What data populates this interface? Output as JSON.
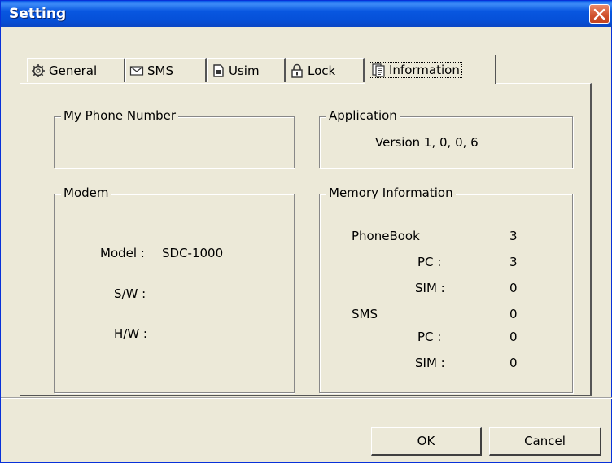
{
  "window": {
    "title": "Setting"
  },
  "tabs": [
    {
      "label": "General",
      "icon": "gear-icon"
    },
    {
      "label": "SMS",
      "icon": "envelope-icon"
    },
    {
      "label": "Usim",
      "icon": "sim-card-icon"
    },
    {
      "label": "Lock",
      "icon": "lock-icon"
    },
    {
      "label": "Information",
      "icon": "document-icon",
      "active": true
    }
  ],
  "phone_number": {
    "title": "My Phone Number",
    "value": ""
  },
  "application": {
    "title": "Application",
    "version": "Version 1, 0, 0, 6"
  },
  "modem": {
    "title": "Modem",
    "model_label": "Model :",
    "model_value": "SDC-1000",
    "sw_label": "S/W :",
    "sw_value": "",
    "hw_label": "H/W :",
    "hw_value": ""
  },
  "memory": {
    "title": "Memory Information",
    "phonebook_label": "PhoneBook",
    "phonebook_total": "3",
    "phonebook_pc_label": "PC :",
    "phonebook_pc": "3",
    "phonebook_sim_label": "SIM :",
    "phonebook_sim": "0",
    "sms_label": "SMS",
    "sms_total": "0",
    "sms_pc_label": "PC :",
    "sms_pc": "0",
    "sms_sim_label": "SIM :",
    "sms_sim": "0"
  },
  "buttons": {
    "ok": "OK",
    "cancel": "Cancel"
  },
  "colors": {
    "titlebar": "#0857e0",
    "face": "#ece9d8",
    "close": "#d0512c"
  }
}
